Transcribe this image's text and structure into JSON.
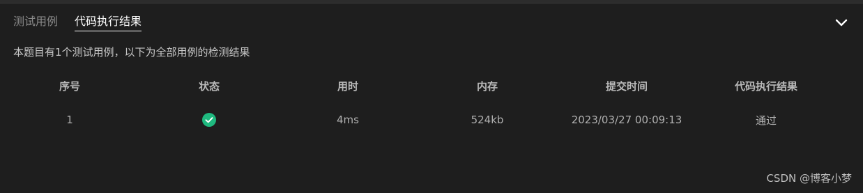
{
  "tabs": [
    {
      "label": "测试用例",
      "active": false
    },
    {
      "label": "代码执行结果",
      "active": true
    }
  ],
  "summary": "本题目有1个测试用例，以下为全部用例的检测结果",
  "table": {
    "headers": [
      "序号",
      "状态",
      "用时",
      "内存",
      "提交时间",
      "代码执行结果"
    ],
    "rows": [
      {
        "index": "1",
        "status_icon": "check-circle-icon",
        "time": "4ms",
        "memory": "524kb",
        "submitted_at": "2023/03/27 00:09:13",
        "result": "通过"
      }
    ]
  },
  "icons": {
    "collapse": "chevron-down-icon"
  },
  "colors": {
    "background": "#1e1e1e",
    "success": "#1fb97f",
    "active_tab": "#ffffff",
    "inactive_tab": "#8c8c8c"
  },
  "watermark": "CSDN @博客小梦"
}
